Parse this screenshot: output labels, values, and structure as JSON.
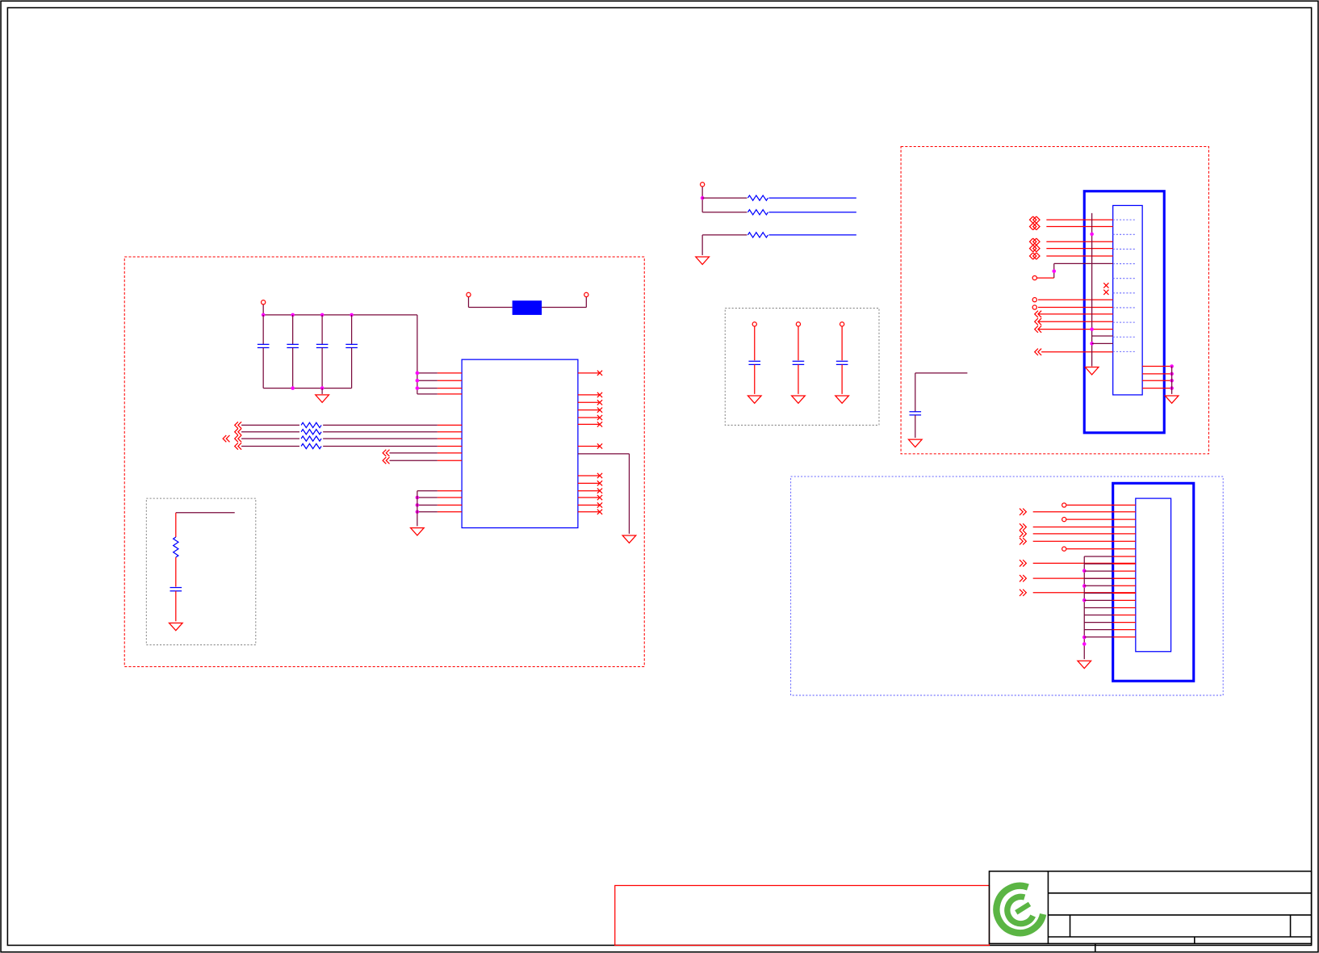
{
  "diagram": {
    "type": "electrical-schematic",
    "colors": {
      "wire": "#7a0a3c",
      "pin": "#ff0000",
      "component": "#0000ff",
      "junction": "#ff00ff",
      "frame": "#000000",
      "logo": "#5bb544"
    },
    "title_block": {
      "logo_icon": "company-logo-icon"
    }
  }
}
